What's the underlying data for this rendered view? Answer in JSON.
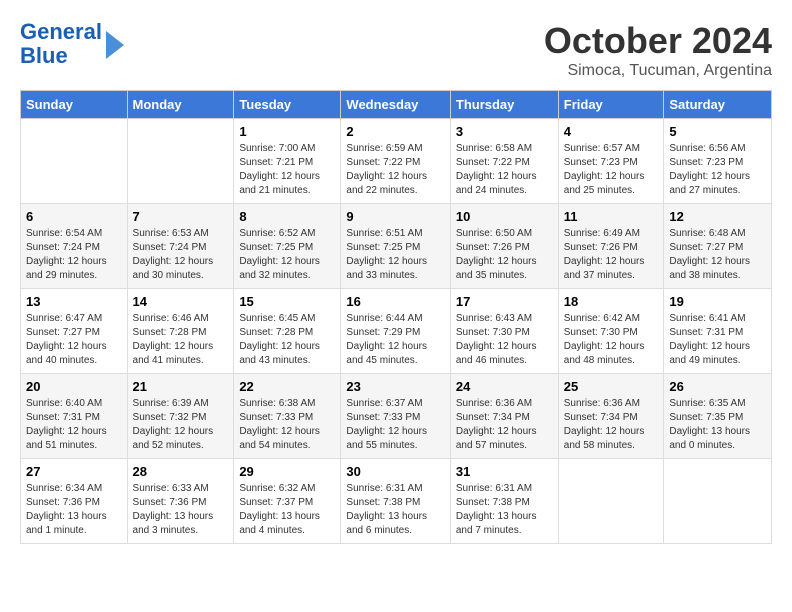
{
  "logo": {
    "line1": "General",
    "line2": "Blue"
  },
  "title": "October 2024",
  "subtitle": "Simoca, Tucuman, Argentina",
  "days_of_week": [
    "Sunday",
    "Monday",
    "Tuesday",
    "Wednesday",
    "Thursday",
    "Friday",
    "Saturday"
  ],
  "weeks": [
    [
      {
        "day": "",
        "sunrise": "",
        "sunset": "",
        "daylight": ""
      },
      {
        "day": "",
        "sunrise": "",
        "sunset": "",
        "daylight": ""
      },
      {
        "day": "1",
        "sunrise": "Sunrise: 7:00 AM",
        "sunset": "Sunset: 7:21 PM",
        "daylight": "Daylight: 12 hours and 21 minutes."
      },
      {
        "day": "2",
        "sunrise": "Sunrise: 6:59 AM",
        "sunset": "Sunset: 7:22 PM",
        "daylight": "Daylight: 12 hours and 22 minutes."
      },
      {
        "day": "3",
        "sunrise": "Sunrise: 6:58 AM",
        "sunset": "Sunset: 7:22 PM",
        "daylight": "Daylight: 12 hours and 24 minutes."
      },
      {
        "day": "4",
        "sunrise": "Sunrise: 6:57 AM",
        "sunset": "Sunset: 7:23 PM",
        "daylight": "Daylight: 12 hours and 25 minutes."
      },
      {
        "day": "5",
        "sunrise": "Sunrise: 6:56 AM",
        "sunset": "Sunset: 7:23 PM",
        "daylight": "Daylight: 12 hours and 27 minutes."
      }
    ],
    [
      {
        "day": "6",
        "sunrise": "Sunrise: 6:54 AM",
        "sunset": "Sunset: 7:24 PM",
        "daylight": "Daylight: 12 hours and 29 minutes."
      },
      {
        "day": "7",
        "sunrise": "Sunrise: 6:53 AM",
        "sunset": "Sunset: 7:24 PM",
        "daylight": "Daylight: 12 hours and 30 minutes."
      },
      {
        "day": "8",
        "sunrise": "Sunrise: 6:52 AM",
        "sunset": "Sunset: 7:25 PM",
        "daylight": "Daylight: 12 hours and 32 minutes."
      },
      {
        "day": "9",
        "sunrise": "Sunrise: 6:51 AM",
        "sunset": "Sunset: 7:25 PM",
        "daylight": "Daylight: 12 hours and 33 minutes."
      },
      {
        "day": "10",
        "sunrise": "Sunrise: 6:50 AM",
        "sunset": "Sunset: 7:26 PM",
        "daylight": "Daylight: 12 hours and 35 minutes."
      },
      {
        "day": "11",
        "sunrise": "Sunrise: 6:49 AM",
        "sunset": "Sunset: 7:26 PM",
        "daylight": "Daylight: 12 hours and 37 minutes."
      },
      {
        "day": "12",
        "sunrise": "Sunrise: 6:48 AM",
        "sunset": "Sunset: 7:27 PM",
        "daylight": "Daylight: 12 hours and 38 minutes."
      }
    ],
    [
      {
        "day": "13",
        "sunrise": "Sunrise: 6:47 AM",
        "sunset": "Sunset: 7:27 PM",
        "daylight": "Daylight: 12 hours and 40 minutes."
      },
      {
        "day": "14",
        "sunrise": "Sunrise: 6:46 AM",
        "sunset": "Sunset: 7:28 PM",
        "daylight": "Daylight: 12 hours and 41 minutes."
      },
      {
        "day": "15",
        "sunrise": "Sunrise: 6:45 AM",
        "sunset": "Sunset: 7:28 PM",
        "daylight": "Daylight: 12 hours and 43 minutes."
      },
      {
        "day": "16",
        "sunrise": "Sunrise: 6:44 AM",
        "sunset": "Sunset: 7:29 PM",
        "daylight": "Daylight: 12 hours and 45 minutes."
      },
      {
        "day": "17",
        "sunrise": "Sunrise: 6:43 AM",
        "sunset": "Sunset: 7:30 PM",
        "daylight": "Daylight: 12 hours and 46 minutes."
      },
      {
        "day": "18",
        "sunrise": "Sunrise: 6:42 AM",
        "sunset": "Sunset: 7:30 PM",
        "daylight": "Daylight: 12 hours and 48 minutes."
      },
      {
        "day": "19",
        "sunrise": "Sunrise: 6:41 AM",
        "sunset": "Sunset: 7:31 PM",
        "daylight": "Daylight: 12 hours and 49 minutes."
      }
    ],
    [
      {
        "day": "20",
        "sunrise": "Sunrise: 6:40 AM",
        "sunset": "Sunset: 7:31 PM",
        "daylight": "Daylight: 12 hours and 51 minutes."
      },
      {
        "day": "21",
        "sunrise": "Sunrise: 6:39 AM",
        "sunset": "Sunset: 7:32 PM",
        "daylight": "Daylight: 12 hours and 52 minutes."
      },
      {
        "day": "22",
        "sunrise": "Sunrise: 6:38 AM",
        "sunset": "Sunset: 7:33 PM",
        "daylight": "Daylight: 12 hours and 54 minutes."
      },
      {
        "day": "23",
        "sunrise": "Sunrise: 6:37 AM",
        "sunset": "Sunset: 7:33 PM",
        "daylight": "Daylight: 12 hours and 55 minutes."
      },
      {
        "day": "24",
        "sunrise": "Sunrise: 6:36 AM",
        "sunset": "Sunset: 7:34 PM",
        "daylight": "Daylight: 12 hours and 57 minutes."
      },
      {
        "day": "25",
        "sunrise": "Sunrise: 6:36 AM",
        "sunset": "Sunset: 7:34 PM",
        "daylight": "Daylight: 12 hours and 58 minutes."
      },
      {
        "day": "26",
        "sunrise": "Sunrise: 6:35 AM",
        "sunset": "Sunset: 7:35 PM",
        "daylight": "Daylight: 13 hours and 0 minutes."
      }
    ],
    [
      {
        "day": "27",
        "sunrise": "Sunrise: 6:34 AM",
        "sunset": "Sunset: 7:36 PM",
        "daylight": "Daylight: 13 hours and 1 minute."
      },
      {
        "day": "28",
        "sunrise": "Sunrise: 6:33 AM",
        "sunset": "Sunset: 7:36 PM",
        "daylight": "Daylight: 13 hours and 3 minutes."
      },
      {
        "day": "29",
        "sunrise": "Sunrise: 6:32 AM",
        "sunset": "Sunset: 7:37 PM",
        "daylight": "Daylight: 13 hours and 4 minutes."
      },
      {
        "day": "30",
        "sunrise": "Sunrise: 6:31 AM",
        "sunset": "Sunset: 7:38 PM",
        "daylight": "Daylight: 13 hours and 6 minutes."
      },
      {
        "day": "31",
        "sunrise": "Sunrise: 6:31 AM",
        "sunset": "Sunset: 7:38 PM",
        "daylight": "Daylight: 13 hours and 7 minutes."
      },
      {
        "day": "",
        "sunrise": "",
        "sunset": "",
        "daylight": ""
      },
      {
        "day": "",
        "sunrise": "",
        "sunset": "",
        "daylight": ""
      }
    ]
  ]
}
